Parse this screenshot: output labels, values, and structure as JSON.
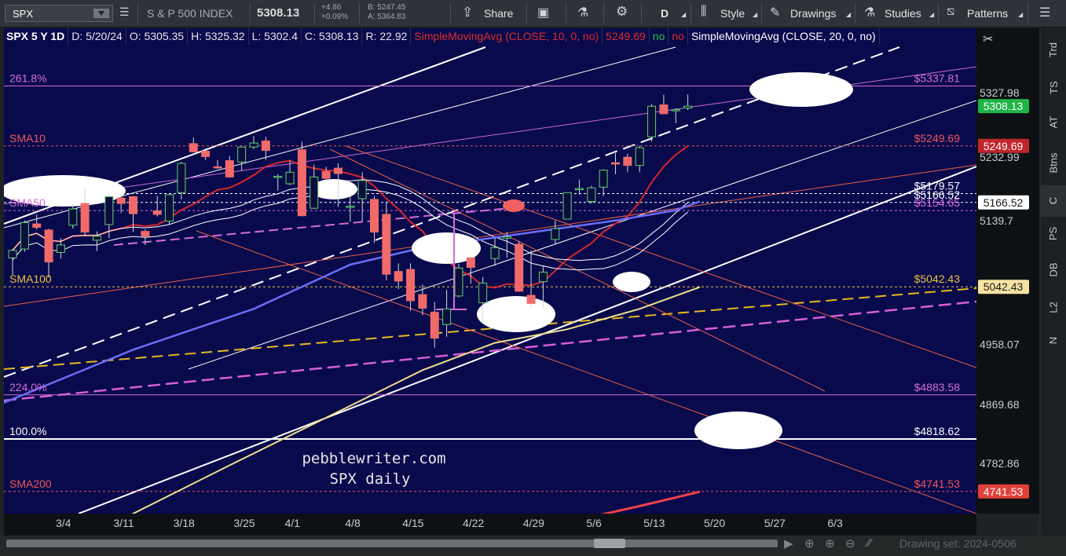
{
  "toolbar": {
    "symbol": "SPX",
    "description": "S & P 500 INDEX",
    "last": "5308.13",
    "change": "+4.86",
    "change_pct": "+0.09%",
    "bid": "B: 5247.45",
    "ask": "A: 5364.83",
    "share_label": "Share",
    "period_label": "D",
    "style_label": "Style",
    "drawings_label": "Drawings",
    "studies_label": "Studies",
    "patterns_label": "Patterns"
  },
  "infobar": {
    "chart_id": "SPX 5 Y 1D",
    "date": "D: 5/20/24",
    "open": "O: 5305.35",
    "high": "H: 5325.32",
    "low": "L: 5302.4",
    "close": "C: 5308.13",
    "range": "R: 22.92",
    "study1": "SimpleMovingAvg (CLOSE, 10, 0, no)",
    "study1_value": "5249.69",
    "study1_flag1": "no",
    "study1_flag2": "no",
    "study2": "SimpleMovingAvg (CLOSE, 20, 0, no)"
  },
  "right_strip": [
    "Trd",
    "TS",
    "AT",
    "Btns",
    "C",
    "PS",
    "DB",
    "L2",
    "N"
  ],
  "bottom": {
    "drawing_set": "Drawing set: 2024-0506"
  },
  "chart_data": {
    "type": "candlestick",
    "ylim": [
      4700,
      5390
    ],
    "x_tick_labels": [
      "3/4",
      "3/11",
      "3/18",
      "3/25",
      "4/1",
      "4/8",
      "4/15",
      "4/22",
      "4/29",
      "5/6",
      "5/13",
      "5/20",
      "5/27",
      "6/3"
    ],
    "y_tick_labels": [
      "5327.98",
      "5232.99",
      "5139.7",
      "4958.07",
      "4869.68",
      "4782.86"
    ],
    "watermark": [
      "pebblewriter.com",
      "SPX daily"
    ],
    "price_badges": [
      {
        "value": "5308.13",
        "color": "#1fb447",
        "text_color": "#ffffff"
      },
      {
        "value": "5249.69",
        "color": "#c0262c",
        "text_color": "#ffffff"
      },
      {
        "value": "5166.52",
        "color": "#ffffff",
        "text_color": "#1a1a1a"
      },
      {
        "value": "5042.43",
        "color": "#f6e3a3",
        "text_color": "#1a1a1a"
      },
      {
        "value": "4741.53",
        "color": "#e0413a",
        "text_color": "#ffffff"
      }
    ],
    "levels": [
      {
        "value": 5337.81,
        "left": "261.8%",
        "right": "$5337.81",
        "color": "#d86bd8"
      },
      {
        "value": 5249.69,
        "left": "SMA10",
        "right": "$5249.69",
        "color": "#f0555a"
      },
      {
        "value": 5179.57,
        "left": "",
        "right": "$5179.57",
        "color": "#ffffff"
      },
      {
        "value": 5166.52,
        "left": "",
        "right": "$5166.52",
        "color": "#ffffff"
      },
      {
        "value": 5154.65,
        "left": "SMA50",
        "right": "$5154.65",
        "color": "#d86bd8"
      },
      {
        "value": 5042.43,
        "left": "SMA100",
        "right": "$5042.43",
        "color": "#f0c040"
      },
      {
        "value": 4883.58,
        "left": "224.0%",
        "right": "$4883.58",
        "color": "#d86bd8"
      },
      {
        "value": 4818.62,
        "left": "100.0%",
        "right": "$4818.62",
        "color": "#ffffff"
      },
      {
        "value": 4741.53,
        "left": "SMA200",
        "right": "$4741.53",
        "color": "#f0555a"
      }
    ],
    "candles": [
      {
        "d": "2/29",
        "o": 5085,
        "h": 5098,
        "l": 5060,
        "c": 5096
      },
      {
        "d": "3/1",
        "o": 5098,
        "h": 5140,
        "l": 5094,
        "c": 5137
      },
      {
        "d": "3/4",
        "o": 5135,
        "h": 5149,
        "l": 5127,
        "c": 5130
      },
      {
        "d": "3/5",
        "o": 5126,
        "h": 5128,
        "l": 5056,
        "c": 5079
      },
      {
        "d": "3/6",
        "o": 5093,
        "h": 5114,
        "l": 5084,
        "c": 5104
      },
      {
        "d": "3/7",
        "o": 5133,
        "h": 5165,
        "l": 5128,
        "c": 5157
      },
      {
        "d": "3/8",
        "o": 5165,
        "h": 5189,
        "l": 5117,
        "c": 5123
      },
      {
        "d": "3/11",
        "o": 5111,
        "h": 5124,
        "l": 5095,
        "c": 5117
      },
      {
        "d": "3/12",
        "o": 5134,
        "h": 5179,
        "l": 5114,
        "c": 5175
      },
      {
        "d": "3/13",
        "o": 5173,
        "h": 5179,
        "l": 5151,
        "c": 5165
      },
      {
        "d": "3/14",
        "o": 5175,
        "h": 5176,
        "l": 5123,
        "c": 5150
      },
      {
        "d": "3/15",
        "o": 5124,
        "h": 5127,
        "l": 5104,
        "c": 5117
      },
      {
        "d": "3/18",
        "o": 5154,
        "h": 5176,
        "l": 5146,
        "c": 5149
      },
      {
        "d": "3/19",
        "o": 5139,
        "h": 5180,
        "l": 5134,
        "c": 5178
      },
      {
        "d": "3/20",
        "o": 5181,
        "h": 5226,
        "l": 5171,
        "c": 5224
      },
      {
        "d": "3/21",
        "o": 5253,
        "h": 5262,
        "l": 5240,
        "c": 5241
      },
      {
        "d": "3/22",
        "o": 5242,
        "h": 5246,
        "l": 5229,
        "c": 5234
      },
      {
        "d": "3/25",
        "o": 5219,
        "h": 5229,
        "l": 5216,
        "c": 5218
      },
      {
        "d": "3/26",
        "o": 5228,
        "h": 5235,
        "l": 5203,
        "c": 5204
      },
      {
        "d": "3/27",
        "o": 5226,
        "h": 5249,
        "l": 5213,
        "c": 5248
      },
      {
        "d": "3/28",
        "o": 5248,
        "h": 5264,
        "l": 5245,
        "c": 5254
      },
      {
        "d": "4/1",
        "o": 5257,
        "h": 5263,
        "l": 5229,
        "c": 5243
      },
      {
        "d": "4/2",
        "o": 5204,
        "h": 5208,
        "l": 5184,
        "c": 5205
      },
      {
        "d": "4/3",
        "o": 5194,
        "h": 5228,
        "l": 5192,
        "c": 5211
      },
      {
        "d": "4/4",
        "o": 5244,
        "h": 5256,
        "l": 5146,
        "c": 5147
      },
      {
        "d": "4/5",
        "o": 5158,
        "h": 5222,
        "l": 5157,
        "c": 5204
      },
      {
        "d": "4/8",
        "o": 5212,
        "h": 5219,
        "l": 5197,
        "c": 5202
      },
      {
        "d": "4/9",
        "o": 5217,
        "h": 5224,
        "l": 5160,
        "c": 5209
      },
      {
        "d": "4/10",
        "o": 5160,
        "h": 5179,
        "l": 5138,
        "c": 5161
      },
      {
        "d": "4/11",
        "o": 5172,
        "h": 5211,
        "l": 5138,
        "c": 5199
      },
      {
        "d": "4/12",
        "o": 5171,
        "h": 5176,
        "l": 5107,
        "c": 5123
      },
      {
        "d": "4/15",
        "o": 5149,
        "h": 5168,
        "l": 5052,
        "c": 5061
      },
      {
        "d": "4/16",
        "o": 5065,
        "h": 5077,
        "l": 5039,
        "c": 5051
      },
      {
        "d": "4/17",
        "o": 5068,
        "h": 5077,
        "l": 5007,
        "c": 5022
      },
      {
        "d": "4/18",
        "o": 5031,
        "h": 5046,
        "l": 5001,
        "c": 5011
      },
      {
        "d": "4/19",
        "o": 5005,
        "h": 5020,
        "l": 4953,
        "c": 4967
      },
      {
        "d": "4/22",
        "o": 4987,
        "h": 5038,
        "l": 4969,
        "c": 5010
      },
      {
        "d": "4/23",
        "o": 5029,
        "h": 5076,
        "l": 5027,
        "c": 5070
      },
      {
        "d": "4/24",
        "o": 5085,
        "h": 5089,
        "l": 5047,
        "c": 5071
      },
      {
        "d": "4/25",
        "o": 5019,
        "h": 5057,
        "l": 4990,
        "c": 5048
      },
      {
        "d": "4/26",
        "o": 5084,
        "h": 5114,
        "l": 5073,
        "c": 5100
      },
      {
        "d": "4/29",
        "o": 5114,
        "h": 5123,
        "l": 5085,
        "c": 5116
      },
      {
        "d": "4/30",
        "o": 5105,
        "h": 5110,
        "l": 5035,
        "c": 5036
      },
      {
        "d": "5/1",
        "o": 5030,
        "h": 5096,
        "l": 5013,
        "c": 5018
      },
      {
        "d": "5/2",
        "o": 5050,
        "h": 5073,
        "l": 5011,
        "c": 5064
      },
      {
        "d": "5/3",
        "o": 5112,
        "h": 5140,
        "l": 5105,
        "c": 5128
      },
      {
        "d": "5/6",
        "o": 5142,
        "h": 5181,
        "l": 5142,
        "c": 5181
      },
      {
        "d": "5/7",
        "o": 5187,
        "h": 5200,
        "l": 5178,
        "c": 5187
      },
      {
        "d": "5/8",
        "o": 5168,
        "h": 5191,
        "l": 5165,
        "c": 5188
      },
      {
        "d": "5/9",
        "o": 5189,
        "h": 5215,
        "l": 5176,
        "c": 5214
      },
      {
        "d": "5/10",
        "o": 5225,
        "h": 5239,
        "l": 5208,
        "c": 5223
      },
      {
        "d": "5/13",
        "o": 5233,
        "h": 5238,
        "l": 5211,
        "c": 5221
      },
      {
        "d": "5/14",
        "o": 5221,
        "h": 5250,
        "l": 5211,
        "c": 5247
      },
      {
        "d": "5/15",
        "o": 5263,
        "h": 5311,
        "l": 5256,
        "c": 5308
      },
      {
        "d": "5/16",
        "o": 5310,
        "h": 5325,
        "l": 5296,
        "c": 5297
      },
      {
        "d": "5/17",
        "o": 5303,
        "h": 5305,
        "l": 5283,
        "c": 5303
      },
      {
        "d": "5/20",
        "o": 5305.35,
        "h": 5325.32,
        "l": 5302.4,
        "c": 5308.13
      }
    ],
    "series": [
      {
        "name": "SMA10",
        "color": "#d8262c"
      },
      {
        "name": "SMA20",
        "color": "#ffffff"
      },
      {
        "name": "SMA50",
        "color": "#6a6ef5"
      },
      {
        "name": "SMA100",
        "color": "#f3e08a"
      },
      {
        "name": "SMA200",
        "color": "#f0414a"
      }
    ]
  }
}
